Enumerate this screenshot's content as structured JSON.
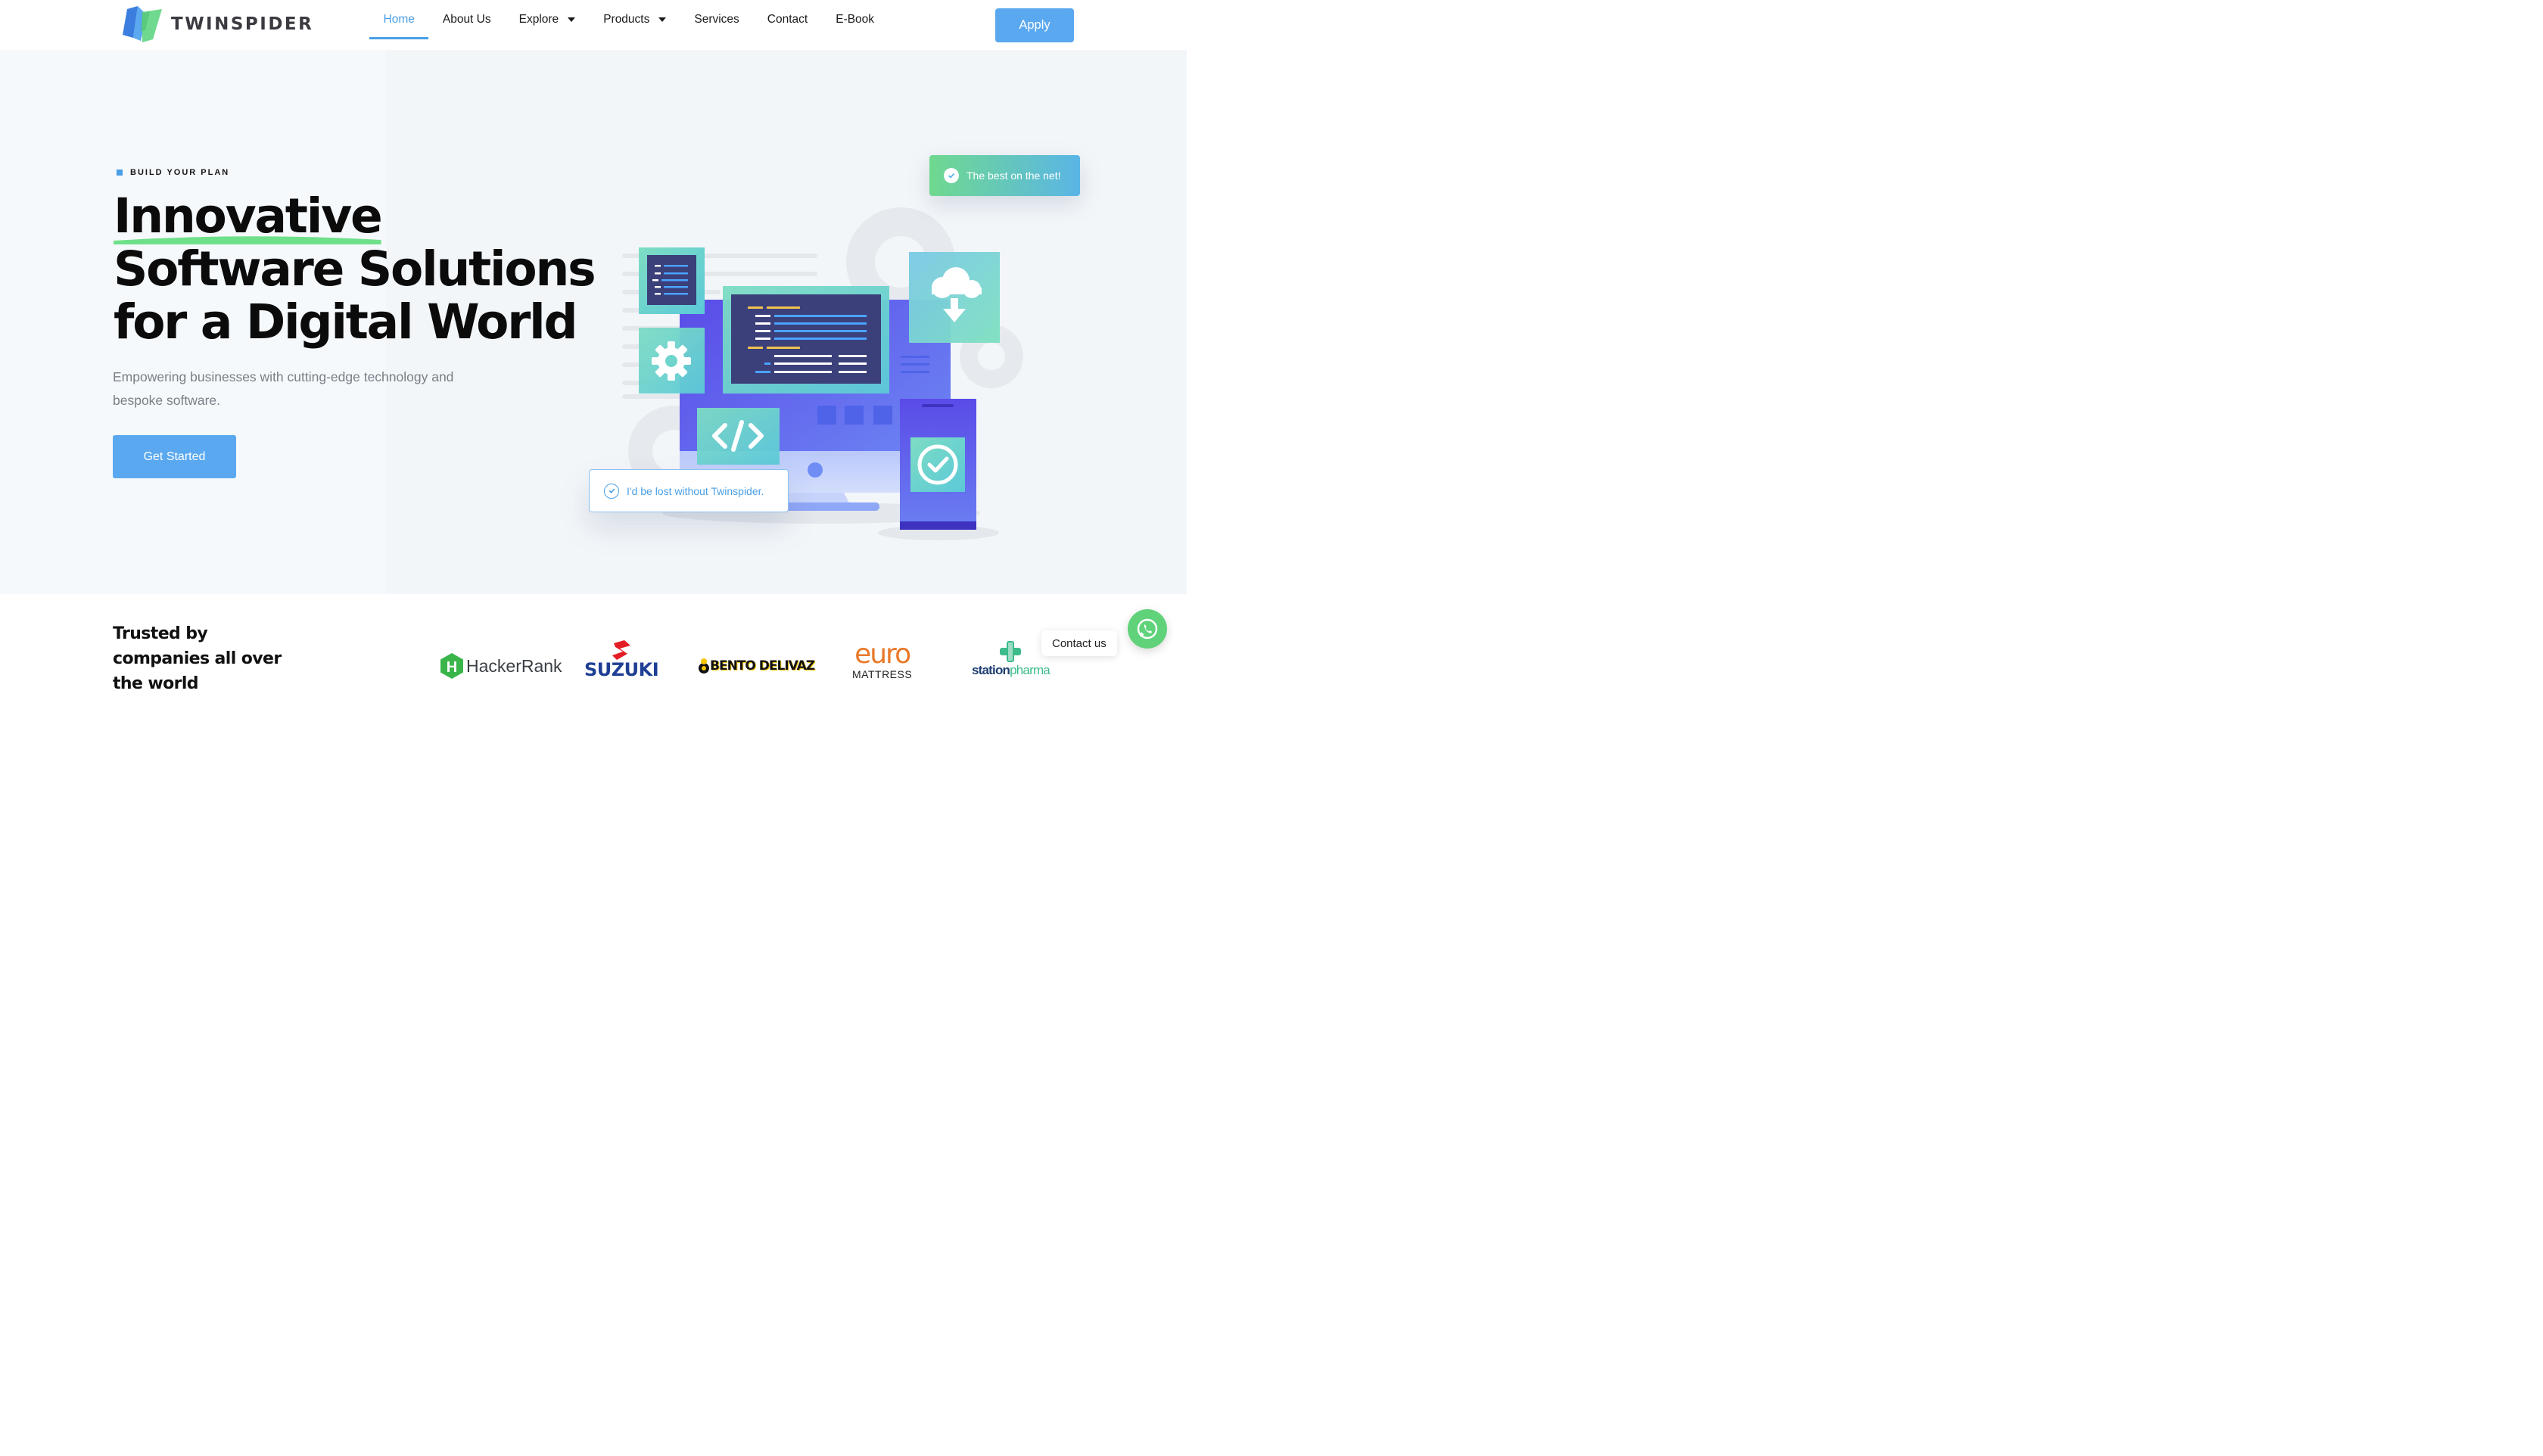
{
  "brand": {
    "name": "TWINSPIDER"
  },
  "nav": {
    "items": [
      {
        "label": "Home",
        "active": true
      },
      {
        "label": "About Us"
      },
      {
        "label": "Explore",
        "dropdown": true
      },
      {
        "label": "Products",
        "dropdown": true
      },
      {
        "label": "Services"
      },
      {
        "label": "Contact"
      },
      {
        "label": "E-Book"
      }
    ],
    "cta": "Apply"
  },
  "hero": {
    "eyebrow": "BUILD YOUR PLAN",
    "headline_lines": [
      "Innovative",
      "Software Solutions",
      "for a Digital World"
    ],
    "subtext": "Empowering businesses with cutting-edge technology and bespoke software.",
    "button": "Get Started",
    "badge_top": "The best on the net!",
    "badge_bottom": "I'd be lost without Twinspider."
  },
  "trusted": {
    "title": "Trusted by companies all over the world",
    "logos": [
      {
        "name": "HackerRank",
        "text": "HackerRank",
        "icon_letter": "H"
      },
      {
        "name": "Suzuki",
        "text": "SUZUKI"
      },
      {
        "name": "Bento Delivaz",
        "text": "BENTO DELIVAZ"
      },
      {
        "name": "Euro Mattress",
        "text_main": "euro",
        "text_sub": "MATTRESS"
      },
      {
        "name": "Station Pharma",
        "text_a": "station",
        "text_b": "pharma"
      }
    ]
  },
  "contact_widget": {
    "label": "Contact us"
  },
  "colors": {
    "accent": "#5aa8ef",
    "green": "#6fd98f",
    "text": "#0b0b0b",
    "muted": "#7a7e86"
  }
}
